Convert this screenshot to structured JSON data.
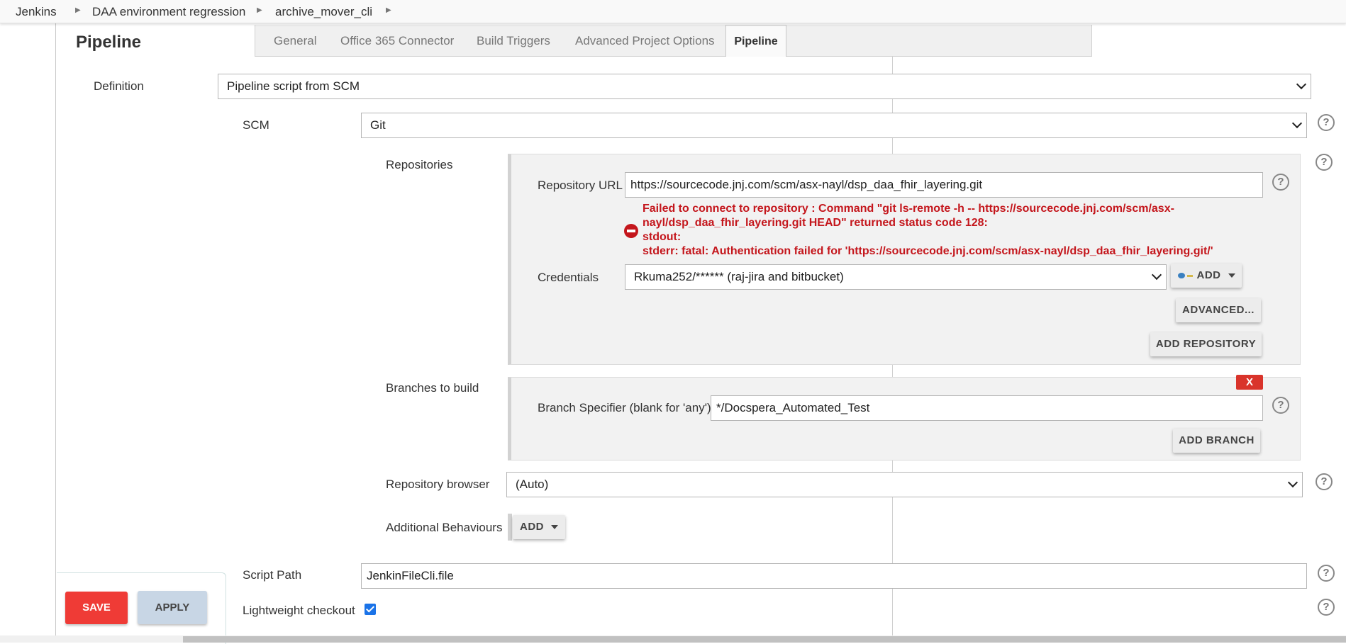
{
  "breadcrumb": {
    "items": [
      "Jenkins",
      "DAA environment regression",
      "archive_mover_cli"
    ]
  },
  "section": {
    "title": "Pipeline"
  },
  "tabs": [
    {
      "label": "General",
      "active": false
    },
    {
      "label": "Office 365 Connector",
      "active": false
    },
    {
      "label": "Build Triggers",
      "active": false
    },
    {
      "label": "Advanced Project Options",
      "active": false
    },
    {
      "label": "Pipeline",
      "active": true
    }
  ],
  "definition": {
    "label": "Definition",
    "value": "Pipeline script from SCM"
  },
  "scm": {
    "label": "SCM",
    "value": "Git"
  },
  "repositories": {
    "label": "Repositories",
    "url_label": "Repository URL",
    "url_value": "https://sourcecode.jnj.com/scm/asx-nayl/dsp_daa_fhir_layering.git",
    "error_lines": [
      "Failed to connect to repository : Command \"git ls-remote -h -- https://sourcecode.jnj.com/scm/asx-",
      "nayl/dsp_daa_fhir_layering.git HEAD\" returned status code 128:",
      "stdout:",
      "stderr: fatal: Authentication failed for 'https://sourcecode.jnj.com/scm/asx-nayl/dsp_daa_fhir_layering.git/'"
    ],
    "credentials_label": "Credentials",
    "credentials_value": "Rkuma252/****** (raj-jira and bitbucket)",
    "add_label": "ADD",
    "advanced_label": "ADVANCED...",
    "add_repository_label": "ADD REPOSITORY"
  },
  "branches": {
    "label": "Branches to build",
    "remove_label": "X",
    "specifier_label": "Branch Specifier (blank for 'any')",
    "specifier_value": "*/Docspera_Automated_Test",
    "add_branch_label": "ADD BRANCH"
  },
  "repo_browser": {
    "label": "Repository browser",
    "value": "(Auto)"
  },
  "behaviours": {
    "label": "Additional Behaviours",
    "add_label": "ADD"
  },
  "script_path": {
    "label": "Script Path",
    "value": "JenkinFileCli.file"
  },
  "lightweight": {
    "label": "Lightweight checkout",
    "checked": true
  },
  "actions": {
    "save_label": "SAVE",
    "apply_label": "APPLY"
  },
  "help_glyph": "?",
  "colors": {
    "error": "#c4161c",
    "save": "#ef3b36",
    "apply": "#c8d6e5",
    "checkbox": "#1a73e8"
  }
}
